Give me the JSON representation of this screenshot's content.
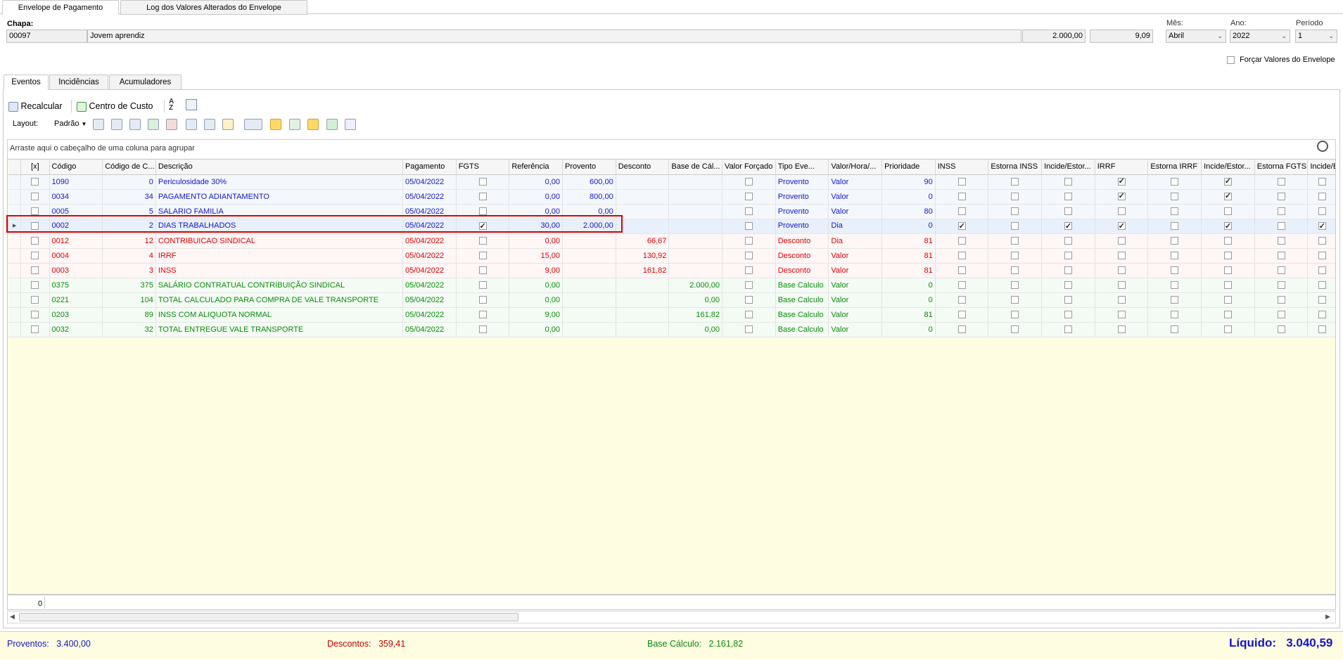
{
  "top_tabs": [
    "Envelope de Pagamento",
    "Log dos Valores Alterados do Envelope"
  ],
  "header": {
    "chapa_label": "Chapa:",
    "chapa_value": "00097",
    "name_value": "Jovem aprendiz",
    "salary_value": "2.000,00",
    "hour_value": "9,09",
    "mes_label": "Mês:",
    "mes_value": "Abril",
    "ano_label": "Ano:",
    "ano_value": "2022",
    "periodo_label": "Período",
    "periodo_value": "1",
    "forcar_label": "Forçar Valores do Envelope"
  },
  "inner_tabs": [
    "Eventos",
    "Incidências",
    "Acumuladores"
  ],
  "toolbar": {
    "recalcular": "Recalcular",
    "centro_custo": "Centro de Custo",
    "layout_label": "Layout:",
    "layout_value": "Padrão"
  },
  "group_hint": "Arraste aqui o cabeçalho de uma coluna para agrupar",
  "columns": [
    "[x]",
    "Código",
    "Código de C...",
    "Descrição",
    "Pagamento",
    "FGTS",
    "Referência",
    "Provento",
    "Desconto",
    "Base de Cál...",
    "Valor Forçado",
    "Tipo Eve...",
    "Valor/Hora/...",
    "Prioridade",
    "INSS",
    "Estorna INSS",
    "Incide/Estor...",
    "IRRF",
    "Estorna IRRF",
    "Incide/Estor...",
    "Estorna FGTS",
    "Incide/Esto"
  ],
  "rows": [
    {
      "color": "blue",
      "codigo": "1090",
      "codc": "0",
      "desc": "Periculosidade 30%",
      "pag": "05/04/2022",
      "fgts": false,
      "ref": "0,00",
      "prov": "600,00",
      "desc_val": "",
      "base": "",
      "tipo": "Provento",
      "vh": "Valor",
      "prio": "90",
      "checks": [
        false,
        false,
        false,
        true,
        false,
        true,
        false,
        false
      ]
    },
    {
      "color": "blue",
      "codigo": "0034",
      "codc": "34",
      "desc": "PAGAMENTO ADIANTAMENTO",
      "pag": "05/04/2022",
      "fgts": false,
      "ref": "0,00",
      "prov": "800,00",
      "desc_val": "",
      "base": "",
      "tipo": "Provento",
      "vh": "Valor",
      "prio": "0",
      "checks": [
        false,
        false,
        false,
        true,
        false,
        true,
        false,
        false
      ]
    },
    {
      "color": "blue",
      "codigo": "0005",
      "codc": "5",
      "desc": "SALARIO FAMILIA",
      "pag": "05/04/2022",
      "fgts": false,
      "ref": "0,00",
      "prov": "0,00",
      "desc_val": "",
      "base": "",
      "tipo": "Provento",
      "vh": "Valor",
      "prio": "80",
      "checks": [
        false,
        false,
        false,
        false,
        false,
        false,
        false,
        false
      ]
    },
    {
      "color": "blue",
      "selected": true,
      "codigo": "0002",
      "codc": "2",
      "desc": "DIAS TRABALHADOS",
      "pag": "05/04/2022",
      "fgts": true,
      "ref": "30,00",
      "prov": "2.000,00",
      "desc_val": "",
      "base": "",
      "tipo": "Provento",
      "vh": "Dia",
      "prio": "0",
      "checks": [
        true,
        false,
        true,
        true,
        false,
        true,
        false,
        true
      ]
    },
    {
      "color": "red",
      "codigo": "0012",
      "codc": "12",
      "desc": "CONTRIBUICAO SINDICAL",
      "pag": "05/04/2022",
      "fgts": false,
      "ref": "0,00",
      "prov": "",
      "desc_val": "66,67",
      "base": "",
      "tipo": "Desconto",
      "vh": "Dia",
      "prio": "81",
      "checks": [
        false,
        false,
        false,
        false,
        false,
        false,
        false,
        false
      ]
    },
    {
      "color": "red",
      "codigo": "0004",
      "codc": "4",
      "desc": "IRRF",
      "pag": "05/04/2022",
      "fgts": false,
      "ref": "15,00",
      "prov": "",
      "desc_val": "130,92",
      "base": "",
      "tipo": "Desconto",
      "vh": "Valor",
      "prio": "81",
      "checks": [
        false,
        false,
        false,
        false,
        false,
        false,
        false,
        false
      ]
    },
    {
      "color": "red",
      "codigo": "0003",
      "codc": "3",
      "desc": "INSS",
      "pag": "05/04/2022",
      "fgts": false,
      "ref": "9,00",
      "prov": "",
      "desc_val": "161,82",
      "base": "",
      "tipo": "Desconto",
      "vh": "Valor",
      "prio": "81",
      "checks": [
        false,
        false,
        false,
        false,
        false,
        false,
        false,
        false
      ]
    },
    {
      "color": "green",
      "codigo": "0375",
      "codc": "375",
      "desc": "SALÁRIO CONTRATUAL CONTRIBUIÇÃO SINDICAL",
      "pag": "05/04/2022",
      "fgts": false,
      "ref": "0,00",
      "prov": "",
      "desc_val": "",
      "base": "2.000,00",
      "tipo": "Base Calculo",
      "vh": "Valor",
      "prio": "0",
      "checks": [
        false,
        false,
        false,
        false,
        false,
        false,
        false,
        false
      ]
    },
    {
      "color": "green",
      "codigo": "0221",
      "codc": "104",
      "desc": "TOTAL CALCULADO PARA COMPRA DE VALE TRANSPORTE",
      "pag": "05/04/2022",
      "fgts": false,
      "ref": "0,00",
      "prov": "",
      "desc_val": "",
      "base": "0,00",
      "tipo": "Base Calculo",
      "vh": "Valor",
      "prio": "0",
      "checks": [
        false,
        false,
        false,
        false,
        false,
        false,
        false,
        false
      ]
    },
    {
      "color": "green",
      "codigo": "0203",
      "codc": "89",
      "desc": "INSS COM ALIQUOTA NORMAL",
      "pag": "05/04/2022",
      "fgts": false,
      "ref": "9,00",
      "prov": "",
      "desc_val": "",
      "base": "161,82",
      "tipo": "Base Calculo",
      "vh": "Valor",
      "prio": "81",
      "checks": [
        false,
        false,
        false,
        false,
        false,
        false,
        false,
        false
      ]
    },
    {
      "color": "green",
      "codigo": "0032",
      "codc": "32",
      "desc": "TOTAL ENTREGUE VALE TRANSPORTE",
      "pag": "05/04/2022",
      "fgts": false,
      "ref": "0,00",
      "prov": "",
      "desc_val": "",
      "base": "0,00",
      "tipo": "Base Calculo",
      "vh": "Valor",
      "prio": "0",
      "checks": [
        false,
        false,
        false,
        false,
        false,
        false,
        false,
        false
      ]
    }
  ],
  "grid_footer_count": "0",
  "totals": {
    "proventos_label": "Proventos:",
    "proventos_value": "3.400,00",
    "descontos_label": "Descontos:",
    "descontos_value": "359,41",
    "base_label": "Base Cálculo:",
    "base_value": "2.161,82",
    "liquido_label": "Líquido:",
    "liquido_value": "3.040,59"
  },
  "colors": {
    "provento": "#1515c9",
    "desconto": "#e00000",
    "base": "#0a8a0a",
    "highlight": "#e00000"
  }
}
